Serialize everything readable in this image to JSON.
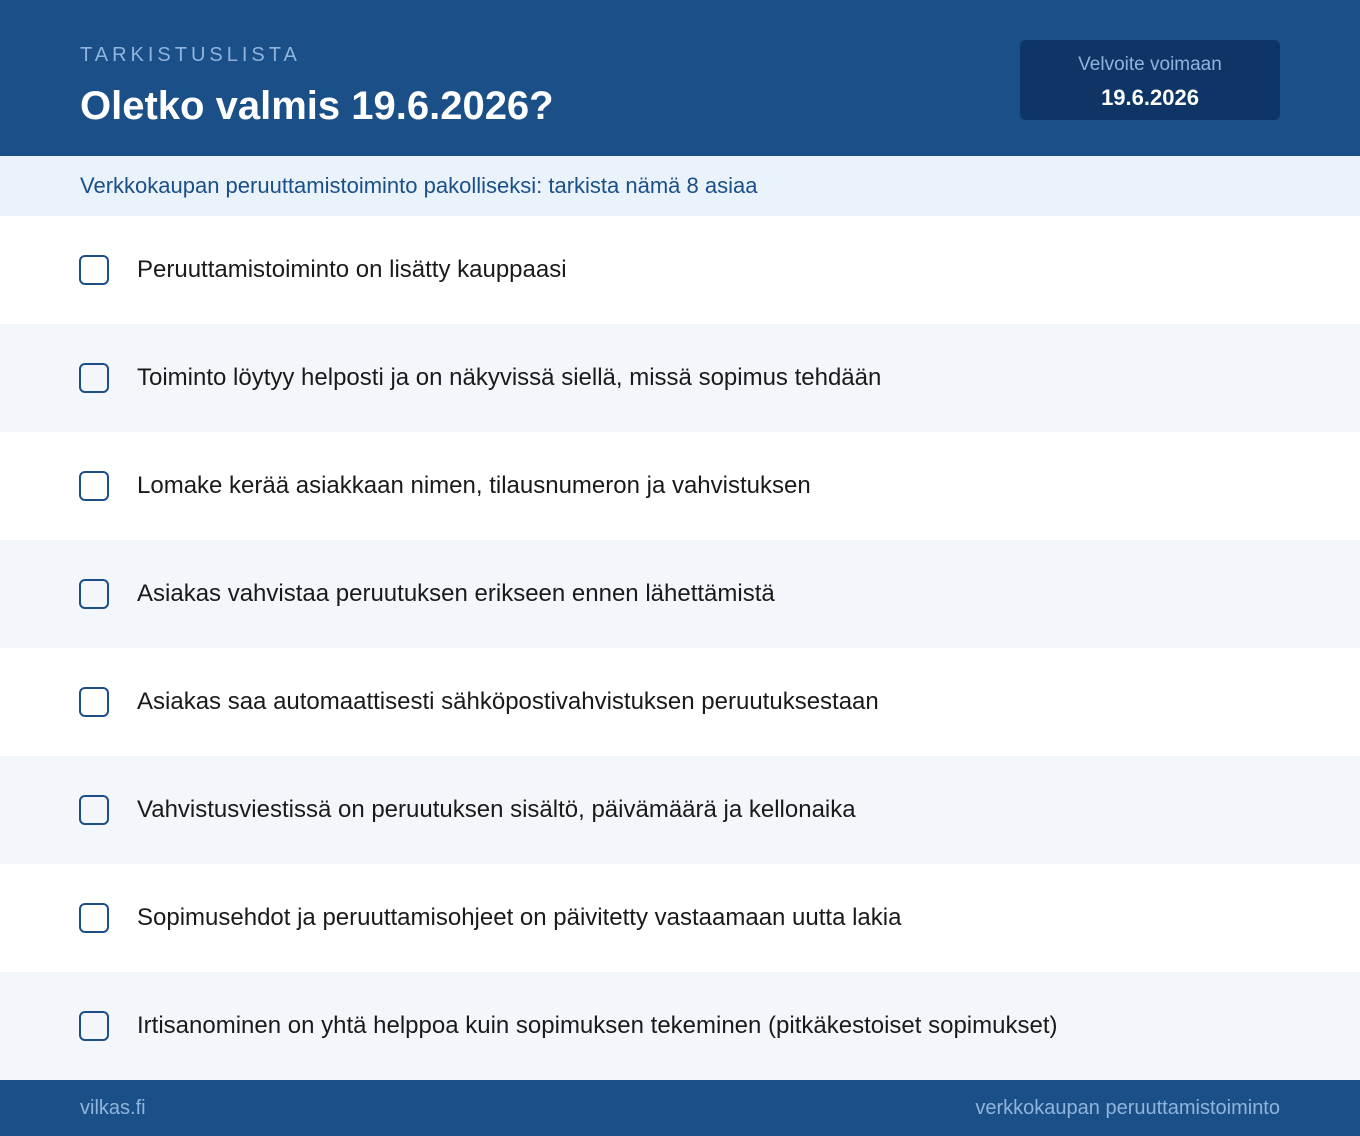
{
  "header": {
    "eyebrow": "TARKISTUSLISTA",
    "title": "Oletko valmis 19.6.2026?",
    "date_box": {
      "label": "Velvoite voimaan",
      "value": "19.6.2026"
    }
  },
  "subheader": {
    "text": "Verkkokaupan peruuttamistoiminto pakolliseksi: tarkista nämä 8 asiaa"
  },
  "checklist": {
    "items": [
      {
        "label": "Peruuttamistoiminto on lisätty kauppaasi",
        "checked": false
      },
      {
        "label": "Toiminto löytyy helposti ja on näkyvissä siellä, missä sopimus tehdään",
        "checked": false
      },
      {
        "label": "Lomake kerää asiakkaan nimen, tilausnumeron ja vahvistuksen",
        "checked": false
      },
      {
        "label": "Asiakas vahvistaa peruutuksen erikseen ennen lähettämistä",
        "checked": false
      },
      {
        "label": "Asiakas saa automaattisesti sähköpostivahvistuksen peruutuksestaan",
        "checked": false
      },
      {
        "label": "Vahvistusviestissä on peruutuksen sisältö, päivämäärä ja kellonaika",
        "checked": false
      },
      {
        "label": "Sopimusehdot ja peruuttamisohjeet on päivitetty vastaamaan uutta lakia",
        "checked": false
      },
      {
        "label": "Irtisanominen on yhtä helppoa kuin sopimuksen tekeminen (pitkäkestoiset sopimukset)",
        "checked": false
      }
    ]
  },
  "footer": {
    "left": "vilkas.fi",
    "right": "verkkokaupan peruuttamistoiminto"
  },
  "colors": {
    "primary": "#1b4f88",
    "date_box_bg": "#0e3566",
    "muted_text": "#8fb4dd",
    "subheader_bg": "#eaf2fb",
    "alt_row_bg": "#f3f7fc"
  }
}
